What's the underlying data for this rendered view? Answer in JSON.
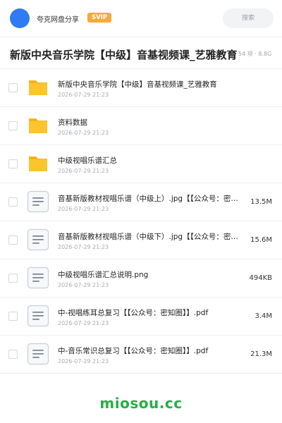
{
  "header": {
    "brand": "夸克网盘分享",
    "badge": "SVIP",
    "search_placeholder": "搜索"
  },
  "title": {
    "text": "新版中央音乐学院【中级】音基视频课_艺雅教育",
    "meta": "54 项 · 8.8G"
  },
  "files": [
    {
      "type": "folder",
      "name": "新版中央音乐学院【中级】音基视频课_艺雅教育",
      "date": "2026-07-29 21:23",
      "size": ""
    },
    {
      "type": "folder",
      "name": "资料数据",
      "date": "2026-07-29 21:23",
      "size": ""
    },
    {
      "type": "folder",
      "name": "中级视唱乐谱汇总",
      "date": "2026-07-29 21:23",
      "size": ""
    },
    {
      "type": "doc",
      "name": "音基新版教材视唱乐谱（中级上）.jpg【【公众号：密知圈】】.jpg",
      "date": "2026-07-29 21:23",
      "size": "13.5M"
    },
    {
      "type": "doc",
      "name": "音基新版教材视唱乐谱（中级下）.jpg【【公众号：密知圈】】.jpg",
      "date": "2026-07-29 21:23",
      "size": "15.6M"
    },
    {
      "type": "doc",
      "name": "中级视唱乐谱汇总说明.png",
      "date": "2026-07-29 21:23",
      "size": "494KB"
    },
    {
      "type": "doc",
      "name": "中-视唱练耳总复习【【公众号：密知圈】】.pdf",
      "date": "2026-07-29 21:23",
      "size": "3.4M"
    },
    {
      "type": "doc",
      "name": "中-音乐常识总复习【【公众号：密知圈】】.pdf",
      "date": "2026-07-29 21:23",
      "size": "21.3M"
    }
  ],
  "footer": {
    "watermark": "miosou.cc"
  },
  "colors": {
    "accent": "#2f7bf6",
    "badge": "#f7a93b",
    "folder": "#fcc52d",
    "watermark": "#27ae45"
  }
}
